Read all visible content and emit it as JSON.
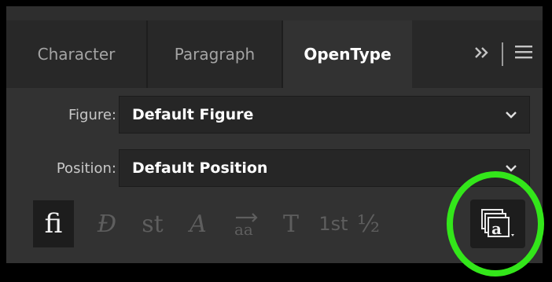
{
  "tabs": [
    {
      "label": "Character",
      "active": false
    },
    {
      "label": "Paragraph",
      "active": false
    },
    {
      "label": "OpenType",
      "active": true
    }
  ],
  "tab_bar": {
    "overflow_label": "»",
    "menu_icon": "hamburger-menu-icon"
  },
  "figure": {
    "label": "Figure:",
    "value": "Default Figure"
  },
  "position": {
    "label": "Position:",
    "value": "Default Position"
  },
  "glyph_buttons": [
    {
      "name": "standard-ligatures",
      "symbol": "fi",
      "active": true
    },
    {
      "name": "contextual-alternates",
      "symbol": "Ɖ",
      "active": false
    },
    {
      "name": "discretionary-ligatures",
      "symbol": "st",
      "active": false
    },
    {
      "name": "swash",
      "symbol": "A",
      "active": false
    },
    {
      "name": "stylistic-alternates",
      "symbol": "aa",
      "active": false
    },
    {
      "name": "titling-alternates",
      "symbol": "T",
      "active": false
    },
    {
      "name": "ordinals",
      "symbol": "1st",
      "active": false
    },
    {
      "name": "fractions",
      "symbol": "½",
      "active": false
    },
    {
      "name": "stylistic-sets",
      "symbol": "a",
      "active": true
    }
  ],
  "colors": {
    "highlight": "#33e61a",
    "panel_bg": "#323232",
    "field_bg": "#262626"
  }
}
